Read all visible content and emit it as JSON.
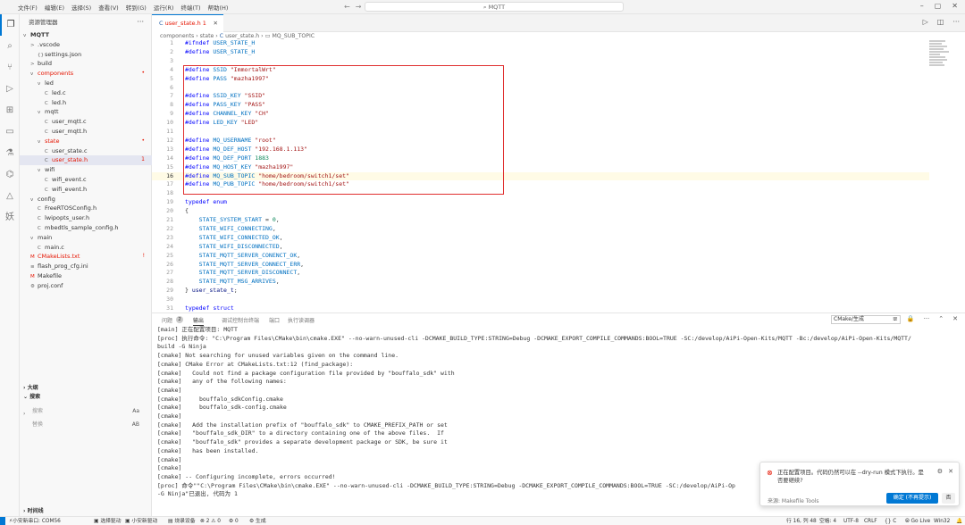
{
  "titlebar": {
    "menus": [
      "文件(F)",
      "编辑(E)",
      "选择(S)",
      "查看(V)",
      "转到(G)",
      "运行(R)",
      "终端(T)",
      "帮助(H)"
    ],
    "search": "MQTT",
    "nav_icons": [
      "arrow-left-icon",
      "arrow-right-icon"
    ]
  },
  "activity": [
    "explorer-icon",
    "search-icon",
    "source-control-icon",
    "run-debug-icon",
    "extensions-icon",
    "remote-explorer-icon",
    "testing-icon",
    "esp-idf-icon",
    "platformio-icon",
    "yao-icon"
  ],
  "sidebar": {
    "title": "资源管理器",
    "tree": [
      {
        "label": "MQTT",
        "icon": "v",
        "depth": 0,
        "bold": true
      },
      {
        "label": ".vscode",
        "icon": ">",
        "depth": 1
      },
      {
        "label": "settings.json",
        "icon": "{}",
        "depth": 2,
        "color": "orange"
      },
      {
        "label": "build",
        "icon": ">",
        "depth": 1
      },
      {
        "label": "components",
        "icon": "v",
        "depth": 1,
        "color": "red",
        "badge": "•"
      },
      {
        "label": "led",
        "icon": "v",
        "depth": 2
      },
      {
        "label": "led.c",
        "icon": "C",
        "depth": 3
      },
      {
        "label": "led.h",
        "icon": "C",
        "depth": 3
      },
      {
        "label": "mqtt",
        "icon": "v",
        "depth": 2
      },
      {
        "label": "user_mqtt.c",
        "icon": "C",
        "depth": 3
      },
      {
        "label": "user_mqtt.h",
        "icon": "C",
        "depth": 3
      },
      {
        "label": "state",
        "icon": "v",
        "depth": 2,
        "color": "red",
        "badge": "•"
      },
      {
        "label": "user_state.c",
        "icon": "C",
        "depth": 3
      },
      {
        "label": "user_state.h",
        "icon": "C",
        "depth": 3,
        "color": "red",
        "badge": "1",
        "selected": true
      },
      {
        "label": "wifi",
        "icon": "v",
        "depth": 2
      },
      {
        "label": "wifi_event.c",
        "icon": "C",
        "depth": 3
      },
      {
        "label": "wifi_event.h",
        "icon": "C",
        "depth": 3
      },
      {
        "label": "config",
        "icon": "v",
        "depth": 1
      },
      {
        "label": "FreeRTOSConfig.h",
        "icon": "C",
        "depth": 2
      },
      {
        "label": "lwipopts_user.h",
        "icon": "C",
        "depth": 2
      },
      {
        "label": "mbedtls_sample_config.h",
        "icon": "C",
        "depth": 2
      },
      {
        "label": "main",
        "icon": "v",
        "depth": 1
      },
      {
        "label": "main.c",
        "icon": "C",
        "depth": 2
      },
      {
        "label": "CMakeLists.txt",
        "icon": "M",
        "depth": 1,
        "color": "red",
        "badge": "!"
      },
      {
        "label": "flash_prog_cfg.ini",
        "icon": "≡",
        "depth": 1
      },
      {
        "label": "Makefile",
        "icon": "M",
        "depth": 1
      },
      {
        "label": "proj.conf",
        "icon": "⚙",
        "depth": 1
      }
    ],
    "outline_label": "大纲",
    "search_label": "搜索",
    "search_placeholder": "搜索",
    "replace_placeholder": "替换",
    "case_toggle": "Aa",
    "replace_toggle": "AB",
    "timeline_label": "时间线"
  },
  "tab": {
    "label": "user_state.h",
    "num": "1"
  },
  "breadcrumb": [
    "components",
    "state",
    "user_state.h",
    "MQ_SUB_TOPIC"
  ],
  "code": [
    {
      "n": "1",
      "t": [
        [
          "kw",
          "#ifndef "
        ],
        [
          "mac",
          "USER_STATE_H"
        ]
      ]
    },
    {
      "n": "2",
      "t": [
        [
          "kw",
          "#define "
        ],
        [
          "mac",
          "USER_STATE_H"
        ]
      ]
    },
    {
      "n": "3",
      "t": []
    },
    {
      "n": "4",
      "t": [
        [
          "kw",
          "#define "
        ],
        [
          "mac",
          "SSID "
        ],
        [
          "str",
          "\"ImmortalWrt\""
        ]
      ]
    },
    {
      "n": "5",
      "t": [
        [
          "kw",
          "#define "
        ],
        [
          "mac",
          "PASS "
        ],
        [
          "str",
          "\"mazha1997\""
        ]
      ]
    },
    {
      "n": "6",
      "t": []
    },
    {
      "n": "7",
      "t": [
        [
          "kw",
          "#define "
        ],
        [
          "mac",
          "SSID_KEY "
        ],
        [
          "str",
          "\"SSID\""
        ]
      ]
    },
    {
      "n": "8",
      "t": [
        [
          "kw",
          "#define "
        ],
        [
          "mac",
          "PASS_KEY "
        ],
        [
          "str",
          "\"PASS\""
        ]
      ]
    },
    {
      "n": "9",
      "t": [
        [
          "kw",
          "#define "
        ],
        [
          "mac",
          "CHANNEL_KEY "
        ],
        [
          "str",
          "\"CH\""
        ]
      ]
    },
    {
      "n": "10",
      "t": [
        [
          "kw",
          "#define "
        ],
        [
          "mac",
          "LED_KEY "
        ],
        [
          "str",
          "\"LED\""
        ]
      ]
    },
    {
      "n": "11",
      "t": []
    },
    {
      "n": "12",
      "t": [
        [
          "kw",
          "#define "
        ],
        [
          "mac",
          "MQ_USERNAME "
        ],
        [
          "str",
          "\"root\""
        ]
      ]
    },
    {
      "n": "13",
      "t": [
        [
          "kw",
          "#define "
        ],
        [
          "mac",
          "MQ_DEF_HOST "
        ],
        [
          "str",
          "\"192.168.1.113\""
        ]
      ]
    },
    {
      "n": "14",
      "t": [
        [
          "kw",
          "#define "
        ],
        [
          "mac",
          "MQ_DEF_PORT "
        ],
        [
          "num",
          "1883"
        ]
      ]
    },
    {
      "n": "15",
      "t": [
        [
          "kw",
          "#define "
        ],
        [
          "mac",
          "MQ_HOST_KEY "
        ],
        [
          "str",
          "\"mazha1997\""
        ]
      ]
    },
    {
      "n": "16",
      "t": [
        [
          "kw",
          "#define "
        ],
        [
          "mac",
          "MQ_SUB_TOPIC "
        ],
        [
          "str",
          "\"home/bedroom/switch1/set\""
        ]
      ],
      "hl": true
    },
    {
      "n": "17",
      "t": [
        [
          "kw",
          "#define "
        ],
        [
          "mac",
          "MQ_PUB_TOPIC "
        ],
        [
          "str",
          "\"home/bedroom/switch1/set\""
        ]
      ]
    },
    {
      "n": "18",
      "t": []
    },
    {
      "n": "19",
      "t": [
        [
          "kw",
          "typedef "
        ],
        [
          "kw",
          "enum"
        ]
      ]
    },
    {
      "n": "20",
      "t": [
        [
          "",
          "{"
        ]
      ]
    },
    {
      "n": "21",
      "t": [
        [
          "",
          "    "
        ],
        [
          "mac",
          "STATE_SYSTEM_START"
        ],
        [
          "",
          " = "
        ],
        [
          "num",
          "0"
        ],
        [
          "",
          ","
        ]
      ]
    },
    {
      "n": "22",
      "t": [
        [
          "",
          "    "
        ],
        [
          "mac",
          "STATE_WIFI_CONNECTING"
        ],
        [
          "",
          ","
        ]
      ]
    },
    {
      "n": "23",
      "t": [
        [
          "",
          "    "
        ],
        [
          "mac",
          "STATE_WIFI_CONNECTED_OK"
        ],
        [
          "",
          ","
        ]
      ]
    },
    {
      "n": "24",
      "t": [
        [
          "",
          "    "
        ],
        [
          "mac",
          "STATE_WIFI_DISCONNECTED"
        ],
        [
          "",
          ","
        ]
      ]
    },
    {
      "n": "25",
      "t": [
        [
          "",
          "    "
        ],
        [
          "mac",
          "STATE_MQTT_SERVER_CONENCT_OK"
        ],
        [
          "",
          ","
        ]
      ]
    },
    {
      "n": "26",
      "t": [
        [
          "",
          "    "
        ],
        [
          "mac",
          "STATE_MQTT_SERVER_CONNECT_ERR"
        ],
        [
          "",
          ","
        ]
      ]
    },
    {
      "n": "27",
      "t": [
        [
          "",
          "    "
        ],
        [
          "mac",
          "STATE_MQTT_SERVER_DISCONNECT"
        ],
        [
          "",
          ","
        ]
      ]
    },
    {
      "n": "28",
      "t": [
        [
          "",
          "    "
        ],
        [
          "mac",
          "STATE_MQTT_MSG_ARRIVES"
        ],
        [
          "",
          ","
        ]
      ]
    },
    {
      "n": "29",
      "t": [
        [
          "",
          "} "
        ],
        [
          "id",
          "user_state_t"
        ],
        [
          "",
          ";"
        ]
      ]
    },
    {
      "n": "30",
      "t": []
    },
    {
      "n": "31",
      "t": [
        [
          "kw",
          "typedef "
        ],
        [
          "kw",
          "struct"
        ]
      ]
    }
  ],
  "panel": {
    "tabs": [
      "问题",
      "输出",
      "调试控制台",
      "终端",
      "端口",
      "执行读调器"
    ],
    "problems_count": "2",
    "active_tab": 1,
    "channel": "CMake/生成",
    "icons": [
      "list-filter-icon",
      "lock-icon",
      "more-icon",
      "maximize-icon",
      "close-icon"
    ]
  },
  "output": [
    "[main] 正在配置项目: MQTT",
    "[proc] 执行命令: \"C:\\Program Files\\CMake\\bin\\cmake.EXE\" --no-warn-unused-cli -DCMAKE_BUILD_TYPE:STRING=Debug -DCMAKE_EXPORT_COMPILE_COMMANDS:BOOL=TRUE -SC:/develop/AiPi-Open-Kits/MQTT -Bc:/develop/AiPi-Open-Kits/MQTT/",
    "build -G Ninja",
    "[cmake] Not searching for unused variables given on the command line.",
    "[cmake] CMake Error at CMakeLists.txt:12 (find_package):",
    "[cmake]   Could not find a package configuration file provided by \"bouffalo_sdk\" with",
    "[cmake]   any of the following names:",
    "[cmake]",
    "[cmake]     bouffalo_sdkConfig.cmake",
    "[cmake]     bouffalo_sdk-config.cmake",
    "[cmake]",
    "[cmake]   Add the installation prefix of \"bouffalo_sdk\" to CMAKE_PREFIX_PATH or set",
    "[cmake]   \"bouffalo_sdk_DIR\" to a directory containing one of the above files.  If",
    "[cmake]   \"bouffalo_sdk\" provides a separate development package or SDK, be sure it",
    "[cmake]   has been installed.",
    "[cmake]",
    "[cmake]",
    "[cmake] -- Configuring incomplete, errors occurred!",
    "[proc] 命令\"\"C:\\Program Files\\CMake\\bin\\cmake.EXE\" --no-warn-unused-cli -DCMAKE_BUILD_TYPE:STRING=Debug -DCMAKE_EXPORT_COMPILE_COMMANDS:BOOL=TRUE -SC:/develop/AiPi-Op",
    "-G Ninja\"已退出, 代码为 1"
  ],
  "notification": {
    "text": "正在配置项目。代码仍然可以在 --dry-run 模式下执行。是否要继续?",
    "source": "来源: Makefile Tools",
    "confirm": "确定 (不再提示)",
    "cancel": "否"
  },
  "statusbar": {
    "left": [
      "⚡小安新串口: COM56",
      "▣ 选择驱动",
      "▣ 小安新驱动",
      "▤ 烧录设备",
      "⊗ 2 ⚠ 0",
      "⚙ 0",
      "⚙ 生成"
    ],
    "right": [
      "行 16, 列 48",
      "空格: 4",
      "UTF-8",
      "CRLF",
      "{} C",
      "⦾ Go Live",
      "Win32",
      "🔔"
    ]
  }
}
